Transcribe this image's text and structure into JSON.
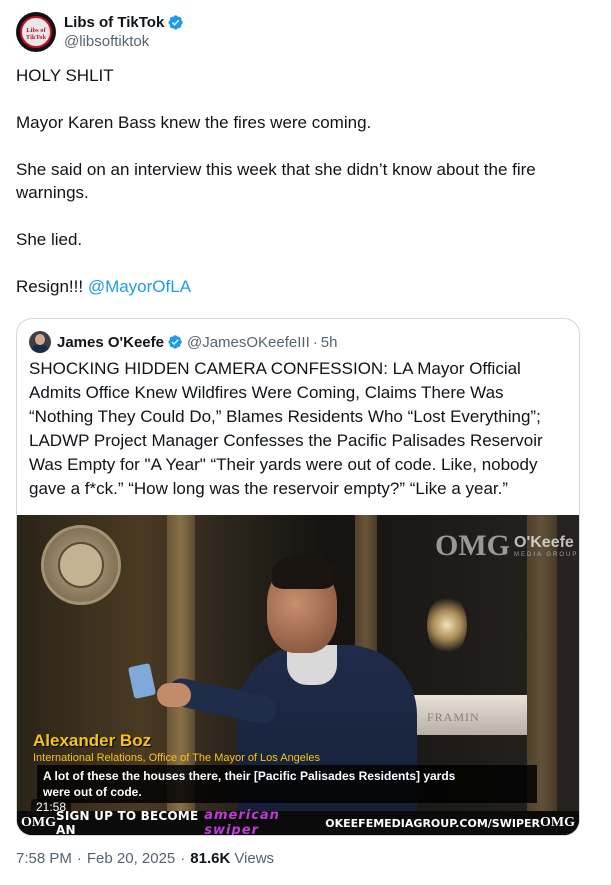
{
  "author": {
    "display_name": "Libs of TikTok",
    "handle": "@libsoftiktok",
    "avatar_text": "Libs of TikTok",
    "verified_icon": "verified-badge-icon"
  },
  "tweet": {
    "lines": [
      "HOLY SHLIT",
      "Mayor Karen Bass knew the fires were coming.",
      "She said on an interview this week that she didn’t know about the fire warnings.",
      "She lied."
    ],
    "final_text": "Resign!!! ",
    "mention": "@MayorOfLA"
  },
  "quote": {
    "display_name": "James O'Keefe",
    "handle": "@JamesOKeefeIII",
    "time": "5h",
    "text": "SHOCKING HIDDEN CAMERA CONFESSION: LA Mayor Official Admits Office Knew Wildfires Were Coming, Claims There Was “Nothing They Could Do,” Blames Residents Who “Lost Everything”; LADWP Project Manager Confesses the Pacific Palisades Reservoir Was Empty for \"A Year\" “Their yards were out of code. Like, nobody gave a f*ck.” “How long was the reservoir empty?” “Like a year.”",
    "video": {
      "watermark_mark": "OMG",
      "watermark_name": "O'Keefe",
      "watermark_sub": "MEDIA GROUP",
      "window_text": "FRAMIN",
      "person_name": "Alexander Boz",
      "person_title": "International Relations, Office of The Mayor of Los Angeles",
      "caption_line1": "A lot of these the houses there, their [Pacific Palisades Residents] yards",
      "caption_line2": "were out of code.",
      "duration": "21:58",
      "banner_mark": "OMG",
      "banner_left": "SIGN UP TO BECOME AN",
      "banner_brand": "american swiper",
      "banner_right": "OKEEFEMEDIAGROUP.COM/SWIPER"
    }
  },
  "meta": {
    "time": "7:58 PM",
    "date": "Feb 20, 2025",
    "views_count": "81.6K",
    "views_label": "Views"
  },
  "colors": {
    "link": "#1d9bf0",
    "secondary_text": "#536471",
    "verified": "#1d9bf0",
    "caption_name": "#f5c518",
    "banner_brand": "#c13bd8"
  }
}
